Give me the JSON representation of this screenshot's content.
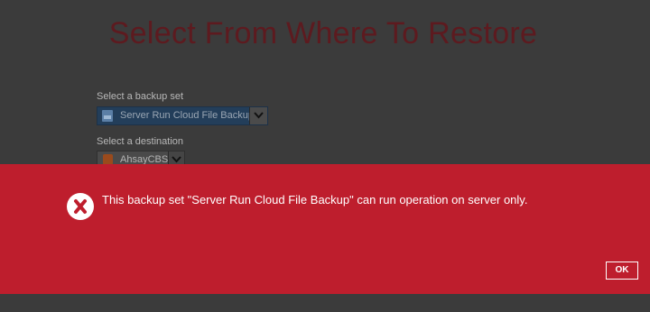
{
  "page": {
    "title": "Select From Where To Restore"
  },
  "backup_set": {
    "label": "Select a backup set",
    "selected": "Server Run Cloud File Backup",
    "icon": "backup-set-icon"
  },
  "destination": {
    "label": "Select a destination",
    "selected": "AhsayCBS",
    "icon": "ahsay-cbs-icon"
  },
  "error_dialog": {
    "message": "This backup set \"Server Run Cloud File Backup\" can run operation on server only.",
    "icon": "error-x-icon",
    "ok_label": "OK",
    "background_color": "#be1e2d"
  }
}
